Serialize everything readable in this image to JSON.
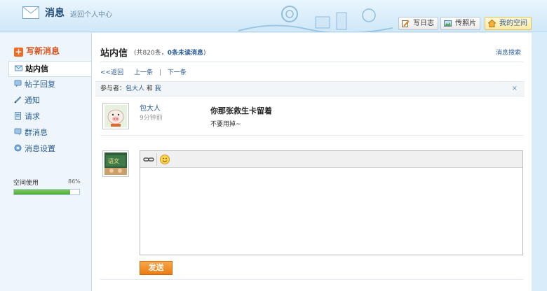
{
  "header": {
    "title": "消息",
    "back_link": "返回个人中心",
    "buttons": [
      {
        "label": "写日志",
        "icon": "pencil-note-icon"
      },
      {
        "label": "传照片",
        "icon": "photo-icon"
      },
      {
        "label": "我的空间",
        "icon": "house-icon"
      }
    ]
  },
  "sidebar": {
    "compose": "写新消息",
    "items": [
      {
        "label": "站内信",
        "icon": "envelope-icon",
        "active": true
      },
      {
        "label": "帖子回复",
        "icon": "reply-bubble-icon"
      },
      {
        "label": "通知",
        "icon": "pencil-icon"
      },
      {
        "label": "请求",
        "icon": "document-icon"
      },
      {
        "label": "群消息",
        "icon": "group-bubble-icon"
      },
      {
        "label": "消息设置",
        "icon": "settings-icon"
      }
    ],
    "space_usage": {
      "label": "空间使用",
      "percent_text": "86%",
      "percent": 0.86
    }
  },
  "main": {
    "title": "站内信",
    "meta_prefix": "(共820条，",
    "meta_unread": "0条未读消息",
    "meta_suffix": ")",
    "search_link": "消息搜索",
    "pager": {
      "back": "<<返回",
      "prev": "上一条",
      "sep": "|",
      "next": "下一条"
    },
    "participants": {
      "prefix": "参与者：",
      "user": "包大人",
      "and": "和",
      "me": "我",
      "close": "×"
    },
    "message": {
      "sender": "包大人",
      "time": "9分钟前",
      "subject": "你那张救生卡留着",
      "body": "不要用掉~"
    },
    "editor": {
      "tools": [
        "link-icon",
        "smiley-icon"
      ]
    },
    "send_label": "发送"
  },
  "colors": {
    "accent": "#ee7d13",
    "link": "#2c5c94",
    "sidebar_bg": "#eef6fc",
    "progress": "#5cb83c"
  }
}
